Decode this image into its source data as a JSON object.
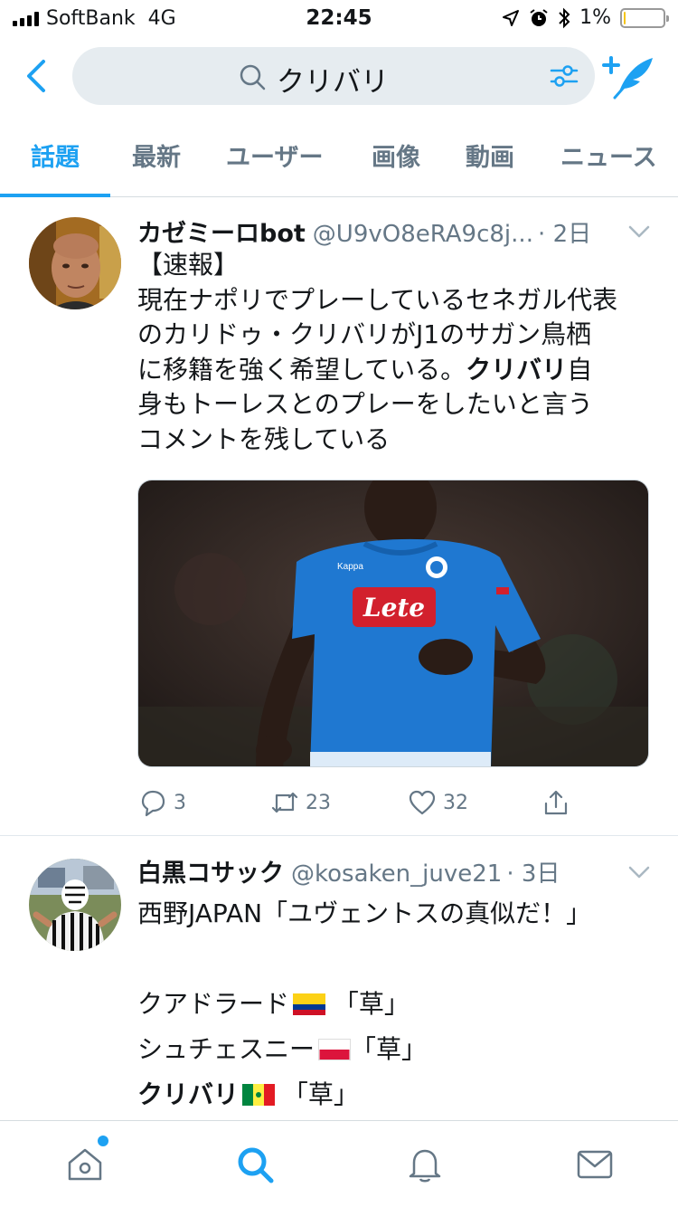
{
  "status_bar": {
    "carrier": "SoftBank",
    "network": "4G",
    "time": "22:45",
    "battery_percent": "1%",
    "battery_level": 0.03
  },
  "search": {
    "query": "クリバリ"
  },
  "tabs": [
    {
      "label": "話題",
      "active": true
    },
    {
      "label": "最新",
      "active": false
    },
    {
      "label": "ユーザー",
      "active": false
    },
    {
      "label": "画像",
      "active": false
    },
    {
      "label": "動画",
      "active": false
    },
    {
      "label": "ニュース",
      "active": false
    }
  ],
  "tweets": [
    {
      "author": "カゼミーロbot",
      "handle": "@U9vO8eRA9c8j...",
      "time": "· 2日",
      "text_lines": [
        [
          "【速報】"
        ],
        [
          "現在ナポリでプレーしているセネガル代表"
        ],
        [
          "のカリドゥ・クリバリがJ1のサガン鳥栖"
        ],
        [
          "に移籍を強く希望している。",
          "クリバリ",
          "自"
        ],
        [
          "身もトーレスとのプレーをしたいと言う"
        ],
        [
          "コメントを残している"
        ]
      ],
      "media_sponsor": "Lete",
      "media_brand": "Kappa",
      "replies": "3",
      "retweets": "23",
      "likes": "32"
    },
    {
      "author": "白黒コサック",
      "handle": "@kosaken_juve21",
      "time": "· 3日",
      "line1": "西野JAPAN「ユヴェントスの真似だ！」",
      "line2": "クアドラード",
      "line2_tail": " 「草」",
      "line3": "シュチェスニー",
      "line3_tail": "「草」",
      "line4_bold": "クリバリ",
      "line4_tail": " 「草」"
    }
  ],
  "colors": {
    "accent": "#1da1f2",
    "secondary_text": "#657786",
    "search_bg": "#e6ecf0"
  },
  "icons": [
    "back-arrow-icon",
    "search-icon",
    "filter-icon",
    "compose-icon",
    "caret-down-icon",
    "reply-icon",
    "retweet-icon",
    "like-icon",
    "share-icon",
    "home-icon",
    "explore-icon",
    "notifications-icon",
    "messages-icon"
  ]
}
